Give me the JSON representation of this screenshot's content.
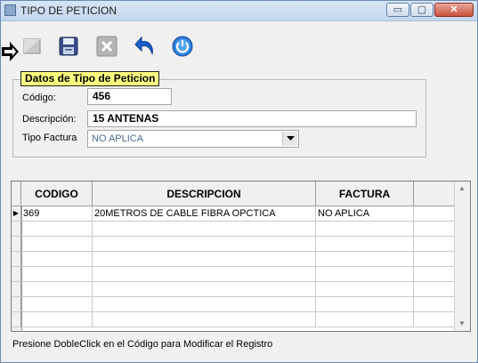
{
  "window": {
    "title": "TIPO DE PETICION",
    "minimize": "▭",
    "maximize": "▢",
    "close": "✕"
  },
  "toolbar": [
    {
      "name": "new-icon"
    },
    {
      "name": "save-icon"
    },
    {
      "name": "delete-icon"
    },
    {
      "name": "undo-icon"
    },
    {
      "name": "exit-icon"
    }
  ],
  "form": {
    "legend": "Datos de Tipo de Peticion",
    "codigo_label": "Código:",
    "codigo_value": "456",
    "descripcion_label": "Descripción:",
    "descripcion_value": "15  ANTENAS",
    "tipo_factura_label": "Tipo Factura",
    "tipo_factura_value": "NO APLICA"
  },
  "grid": {
    "columns": [
      "CODIGO",
      "DESCRIPCION",
      "FACTURA",
      ""
    ],
    "rows": [
      {
        "codigo": "369",
        "descripcion": "20METROS DE CABLE FIBRA OPCTICA",
        "factura": "NO APLICA"
      }
    ]
  },
  "status_text": "Presione DobleClick en el Código para Modificar el Registro"
}
